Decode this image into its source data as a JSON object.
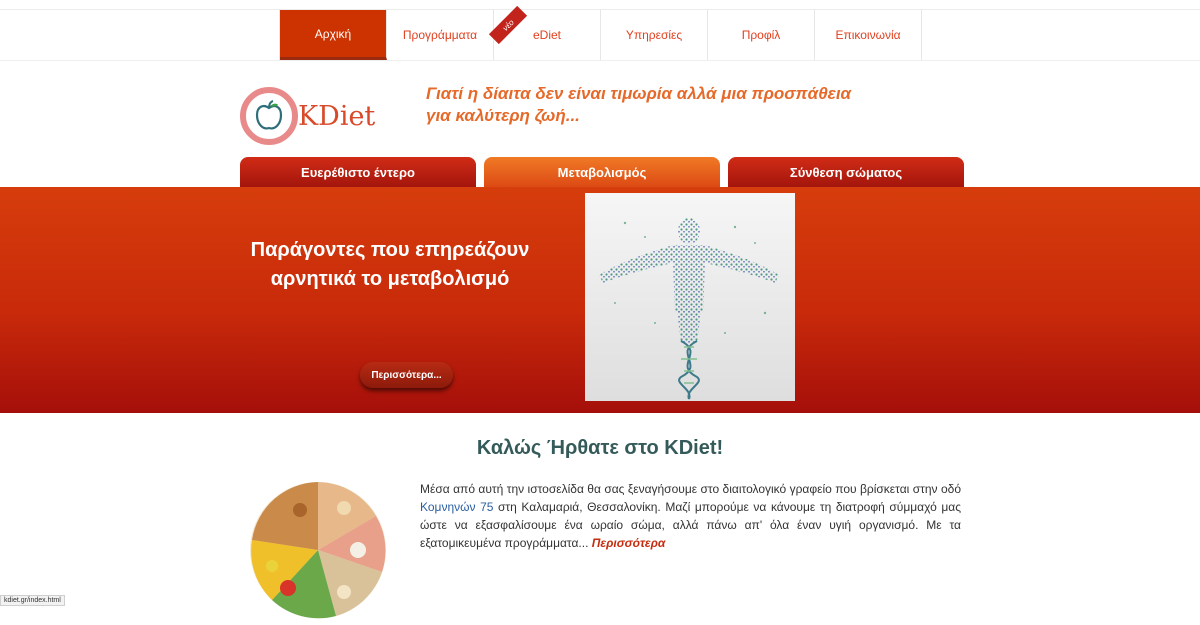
{
  "nav": {
    "items": [
      {
        "label": "Αρχική"
      },
      {
        "label": "Προγράμματα"
      },
      {
        "label": "eDiet",
        "badge": "νέο"
      },
      {
        "label": "Υπηρεσίες"
      },
      {
        "label": "Προφίλ"
      },
      {
        "label": "Επικοινωνία"
      }
    ],
    "active_index": 0
  },
  "brand": {
    "name": "KDiet",
    "tagline": "Γιατί η δίαιτα δεν είναι τιμωρία αλλά μια προσπάθεια για καλύτερη ζωή..."
  },
  "tabs": [
    {
      "label": "Ευερέθιστο έντερο"
    },
    {
      "label": "Μεταβολισμός"
    },
    {
      "label": "Σύνθεση σώματος"
    }
  ],
  "active_tab_index": 1,
  "banner": {
    "title": "Παράγοντες που επηρεάζουν αρνητικά το μεταβολισμό",
    "button_label": "Περισσότερα..."
  },
  "welcome": {
    "title": "Καλώς Ήρθατε στο KDiet!",
    "text_before": "Μέσα από αυτή την ιστοσελίδα θα σας ξεναγήσουμε στο διαιτολογικό γραφείο που βρίσκεται στην οδό ",
    "link_text": "Κομνηνών 75",
    "text_after": " στη Καλαμαριά, Θεσσαλονίκη. Μαζί μπορούμε να κάνουμε τη διατροφή σύμμαχό μας ώστε να εξασφαλίσουμε ένα ωραίο σώμα, αλλά πάνω απ' όλα έναν υγιή οργανισμό. Με τα εξατομικευμένα προγράμματα... ",
    "more_label": "Περισσότερα"
  },
  "status_bar": {
    "url": "kdiet.gr/index.html"
  },
  "colors": {
    "accent": "#cc3300",
    "banner_top": "#d63d0c",
    "banner_bottom": "#a50f0a",
    "tagline": "#e56a2a",
    "welcome_title": "#355a5a",
    "logo_ring": "#e98a8a"
  },
  "icons": {
    "logo": "apple-icon",
    "banner_image": "dna-human-figure",
    "food_image": "food-plate"
  }
}
